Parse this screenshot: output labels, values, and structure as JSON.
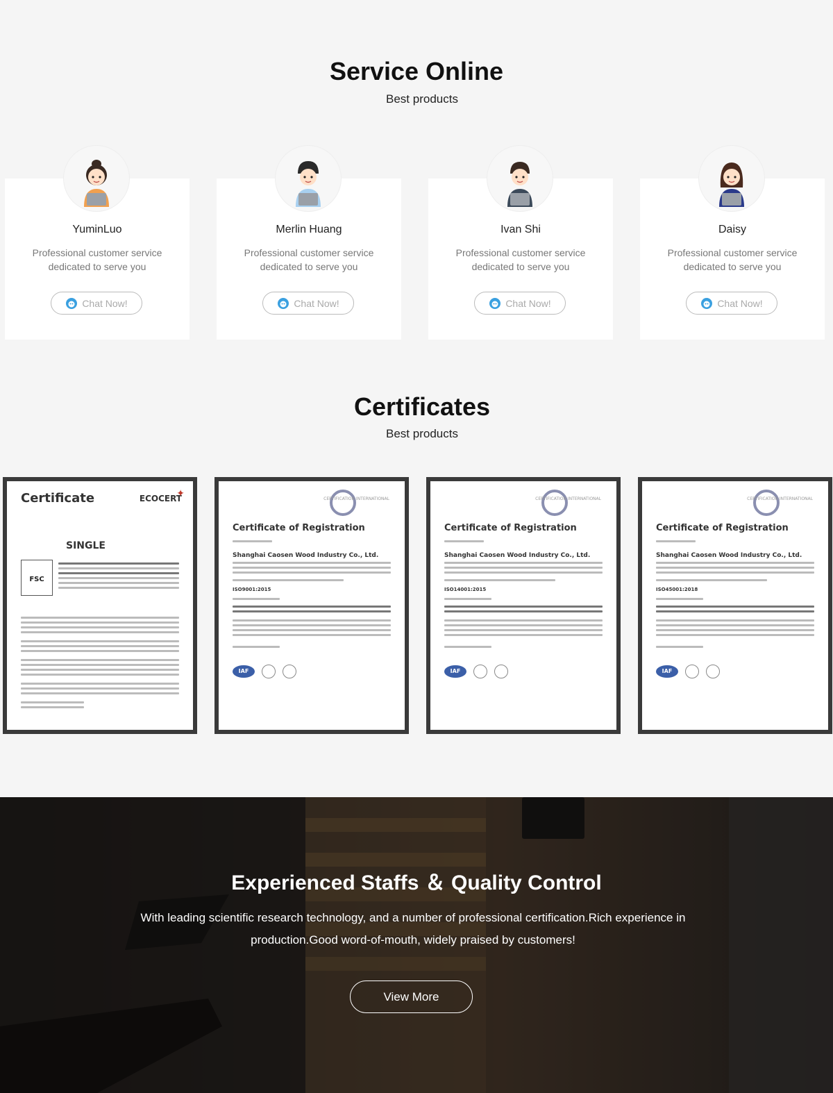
{
  "service": {
    "title": "Service Online",
    "subtitle": "Best products",
    "agents": [
      {
        "name": "YuminLuo",
        "desc": "Professional customer service dedicated to serve you",
        "button": "Chat Now!"
      },
      {
        "name": "Merlin Huang",
        "desc": "Professional customer service dedicated to serve you",
        "button": "Chat Now!"
      },
      {
        "name": "Ivan Shi",
        "desc": "Professional customer service dedicated to serve you",
        "button": "Chat Now!"
      },
      {
        "name": "Daisy",
        "desc": "Professional customer service dedicated to serve you",
        "button": "Chat Now!"
      }
    ]
  },
  "certificates": {
    "title": "Certificates",
    "subtitle": "Best products",
    "items": [
      {
        "heading": "Certificate",
        "brand": "ECOCERT",
        "label": "SINGLE",
        "mark": "FSC"
      },
      {
        "heading": "Certificate of Registration",
        "company": "Shanghai Caosen Wood Industry Co., Ltd.",
        "standard": "ISO9001:2015",
        "logo_text": "CERTIFICATION INTERNATIONAL",
        "badge": "IAF"
      },
      {
        "heading": "Certificate of Registration",
        "company": "Shanghai Caosen Wood Industry Co., Ltd.",
        "standard": "ISO14001:2015",
        "logo_text": "CERTIFICATION INTERNATIONAL",
        "badge": "IAF"
      },
      {
        "heading": "Certificate of Registration",
        "company": "Shanghai Caosen Wood Industry Co., Ltd.",
        "standard": "ISO45001:2018",
        "logo_text": "CERTIFICATION INTERNATIONAL",
        "badge": "IAF"
      }
    ]
  },
  "hero": {
    "title": "Experienced Staffs ＆ Quality Control",
    "text": "With leading scientific research technology, and a number of professional certification.Rich experience in production.Good word-of-mouth, widely praised by  customers!",
    "button": "View More"
  },
  "colors": {
    "background": "#f5f5f5",
    "card": "#ffffff",
    "frame": "#3a3a3a",
    "iaf": "#3b5fa8"
  }
}
